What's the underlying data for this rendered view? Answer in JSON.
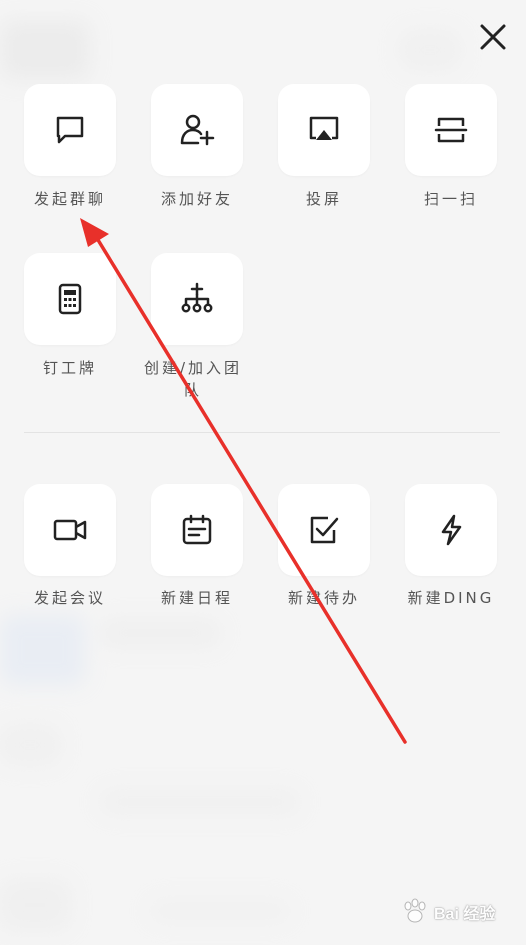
{
  "overlay": {
    "close_icon": "close-icon"
  },
  "quick_actions": [
    {
      "label": "发起群聊",
      "icon": "chat-bubble-icon"
    },
    {
      "label": "添加好友",
      "icon": "add-user-icon"
    },
    {
      "label": "投屏",
      "icon": "screen-cast-icon"
    },
    {
      "label": "扫一扫",
      "icon": "scan-icon"
    },
    {
      "label": "钉工牌",
      "icon": "work-badge-icon"
    },
    {
      "label": "创建/加入团队",
      "icon": "team-tree-icon"
    }
  ],
  "create_actions": [
    {
      "label": "发起会议",
      "icon": "video-camera-icon"
    },
    {
      "label": "新建日程",
      "icon": "calendar-icon"
    },
    {
      "label": "新建待办",
      "icon": "checkbox-icon"
    },
    {
      "label": "新建DING",
      "icon": "lightning-icon"
    }
  ],
  "watermark": {
    "text": "Bai 经验"
  },
  "annotation": {
    "arrow_color": "#e8302a"
  }
}
